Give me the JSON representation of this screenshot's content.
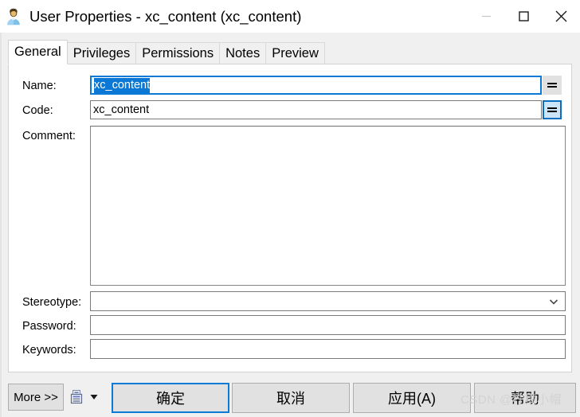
{
  "window": {
    "title": "User Properties - xc_content (xc_content)",
    "icon": "user-icon",
    "controls": {
      "minimize": "minimize-icon",
      "maximize": "maximize-icon",
      "close": "close-icon"
    }
  },
  "tabs": [
    {
      "label": "General",
      "active": true
    },
    {
      "label": "Privileges",
      "active": false
    },
    {
      "label": "Permissions",
      "active": false
    },
    {
      "label": "Notes",
      "active": false
    },
    {
      "label": "Preview",
      "active": false
    }
  ],
  "form": {
    "name": {
      "label": "Name:",
      "value": "xc_content",
      "placeholder": "",
      "selected": true,
      "focused": true,
      "side_button": "="
    },
    "code": {
      "label": "Code:",
      "value": "xc_content",
      "placeholder": "",
      "selected": false,
      "focused": false,
      "side_button": "="
    },
    "comment": {
      "label": "Comment:",
      "value": "",
      "placeholder": ""
    },
    "stereotype": {
      "label": "Stereotype:",
      "value": "",
      "placeholder": "",
      "arrow": "chevron-down-icon"
    },
    "password": {
      "label": "Password:",
      "value": "",
      "placeholder": ""
    },
    "keywords": {
      "label": "Keywords:",
      "value": "",
      "placeholder": ""
    }
  },
  "footer": {
    "more": "More >>",
    "report_icon": "report-icon",
    "report_caret": "dropdown-caret-icon",
    "ok": "确定",
    "cancel": "取消",
    "apply": "应用(A)",
    "help": "帮助"
  },
  "watermark": {
    "text": "CSDN @柠檬小帽"
  },
  "colors": {
    "accent": "#0a7ad6",
    "selection": "#0a78d4",
    "button_face": "#e1e1e1",
    "window_face": "#f0f0f0",
    "focus_fill": "#cce4f7"
  }
}
